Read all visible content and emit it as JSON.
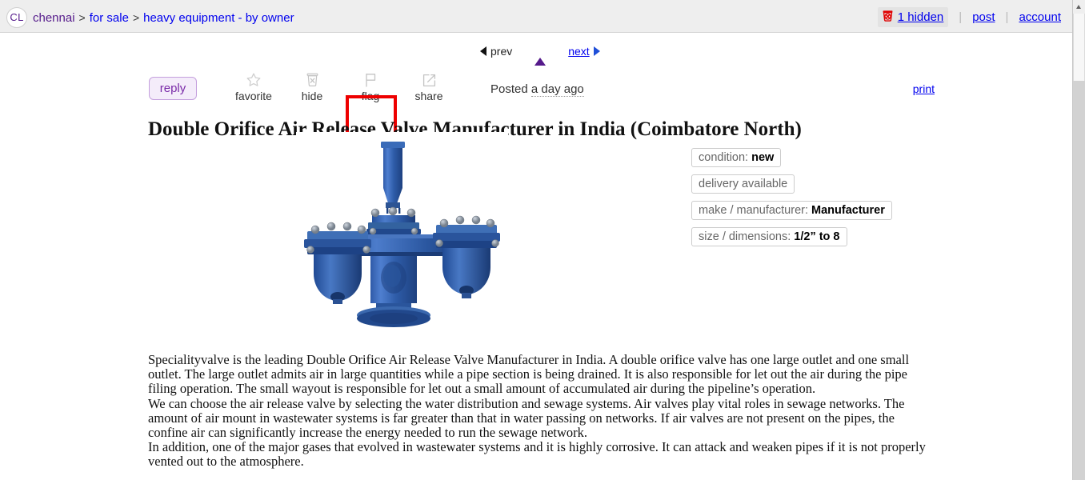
{
  "header": {
    "logo_text": "CL",
    "breadcrumbs": [
      {
        "label": "chennai",
        "kind": "visited"
      },
      {
        "label": "for sale",
        "kind": "link"
      },
      {
        "label": "heavy equipment - by owner",
        "kind": "link"
      }
    ],
    "separator": ">",
    "hidden_count_label": "1 hidden",
    "post_label": "post",
    "account_label": "account",
    "vsep": "|"
  },
  "nav": {
    "prev_label": "prev",
    "next_label": "next",
    "up_label": "up"
  },
  "toolbar": {
    "reply_label": "reply",
    "favorite_label": "favorite",
    "hide_label": "hide",
    "flag_label": "flag",
    "share_label": "share",
    "posted_prefix": "Posted ",
    "posted_ago": "a day ago",
    "print_label": "print",
    "highlight_color": "#ee0000",
    "highlighted_item": "flag"
  },
  "posting": {
    "title": "Double Orifice Air Release Valve Manufacturer in India (Coimbatore North)",
    "image_alt": "blue double orifice air release valve",
    "attributes": [
      {
        "label": "condition: ",
        "value": "new"
      },
      {
        "label": "delivery available",
        "value": ""
      },
      {
        "label": "make / manufacturer: ",
        "value": "Manufacturer"
      },
      {
        "label": "size / dimensions: ",
        "value": "1/2” to 8"
      }
    ],
    "body_paragraphs": [
      "Specialityvalve is the leading Double Orifice Air Release Valve Manufacturer in India. A double orifice valve has one large outlet and one small outlet. The large outlet admits air in large quantities while a pipe section is being drained. It is also responsible for let out the air during the pipe filing operation. The small wayout is responsible for let out a small amount of accumulated air during the pipeline’s operation.",
      "We can choose the air release valve by selecting the water distribution and sewage systems. Air valves play vital roles in sewage networks. The amount of air mount in wastewater systems is far greater than that in water passing on networks. If air valves are not present on the pipes, the confine air can significantly increase the energy needed to run the sewage network.",
      "In addition, one of the major gases that evolved in wastewater systems and it is highly corrosive. It can attack and weaken pipes if it is not properly vented out to the atmosphere."
    ]
  },
  "colors": {
    "link": "#0000ee",
    "visited_link": "#551a8b",
    "reply_accent": "#7a2aa8",
    "header_bg": "#eeeeee"
  }
}
